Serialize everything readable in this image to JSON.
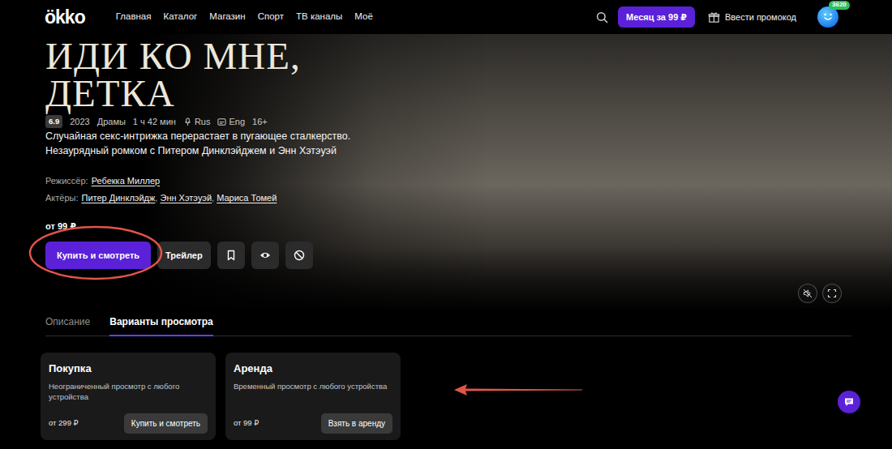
{
  "header": {
    "logo": "ökko",
    "nav": [
      {
        "label": "Главная"
      },
      {
        "label": "Каталог"
      },
      {
        "label": "Магазин"
      },
      {
        "label": "Спорт"
      },
      {
        "label": "ТВ каналы"
      },
      {
        "label": "Моё"
      }
    ],
    "subscribe_button": "Месяц за 99 ₽",
    "promo": "Ввести промокод",
    "bonus_badge": "3620"
  },
  "movie": {
    "title_lines": [
      "ИДИ КО МНЕ,",
      "ДЕТКА"
    ],
    "rating": "6.9",
    "year": "2023",
    "genre": "Драмы",
    "duration": "1 ч 42 мин",
    "audio": "Rus",
    "subtitles": "Eng",
    "age": "16+",
    "description_lines": [
      "Случайная секс-интрижка перерастает в пугающее сталкерство.",
      "Незаурядный ромком с Питером Динклэйджем и Энн Хэтэуэй"
    ],
    "director_label": "Режиссёр:",
    "director": "Ребекка Миллер",
    "actors_label": "Актёры:",
    "actors": [
      "Питер Динклэйдж",
      "Энн Хэтэуэй",
      "Мариса Томей"
    ],
    "actors_separator": ", ",
    "price": "от 99 ₽"
  },
  "actions": {
    "buy": "Купить и смотреть",
    "trailer": "Трейлер"
  },
  "tabs": [
    {
      "label": "Описание",
      "selected": false
    },
    {
      "label": "Варианты просмотра",
      "selected": true
    }
  ],
  "options": [
    {
      "title": "Покупка",
      "description": "Неограниченный просмотр с любого устройства",
      "price": "от 299 ₽",
      "button": "Купить и смотреть"
    },
    {
      "title": "Аренда",
      "description": "Временный просмотр с любого устройства",
      "price": "от 99 ₽",
      "button": "Взять в аренду"
    }
  ],
  "annotations": [
    {
      "kind": "ellipse",
      "color": "#e0554a"
    },
    {
      "kind": "arrow",
      "color": "#e0554a"
    }
  ]
}
